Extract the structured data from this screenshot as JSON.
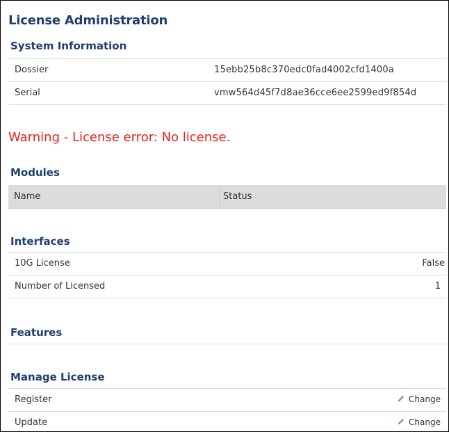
{
  "page": {
    "title": "License Administration"
  },
  "system_information": {
    "title": "System Information",
    "rows": [
      {
        "label": "Dossier",
        "value": "15ebb25b8c370edc0fad4002cfd1400a"
      },
      {
        "label": "Serial",
        "value": "vmw564d45f7d8ae36cce6ee2599ed9f854d"
      }
    ]
  },
  "warning": {
    "text": "Warning - License error: No license."
  },
  "modules": {
    "title": "Modules",
    "columns": [
      "Name",
      "Status"
    ]
  },
  "interfaces": {
    "title": "Interfaces",
    "rows": [
      {
        "label": "10G License",
        "value": "False"
      },
      {
        "label": "Number of Licensed",
        "value": "1"
      }
    ]
  },
  "features": {
    "title": "Features"
  },
  "manage_license": {
    "title": "Manage License",
    "rows": [
      {
        "label": "Register",
        "action": "Change"
      },
      {
        "label": "Update",
        "action": "Change"
      }
    ]
  },
  "colors": {
    "heading": "#1f3f6e",
    "warning": "#e82020",
    "table_header_bg": "#dcdcdc",
    "pencil_icon": "#7a9cc6"
  },
  "icons": {
    "change": "pencil-icon"
  }
}
